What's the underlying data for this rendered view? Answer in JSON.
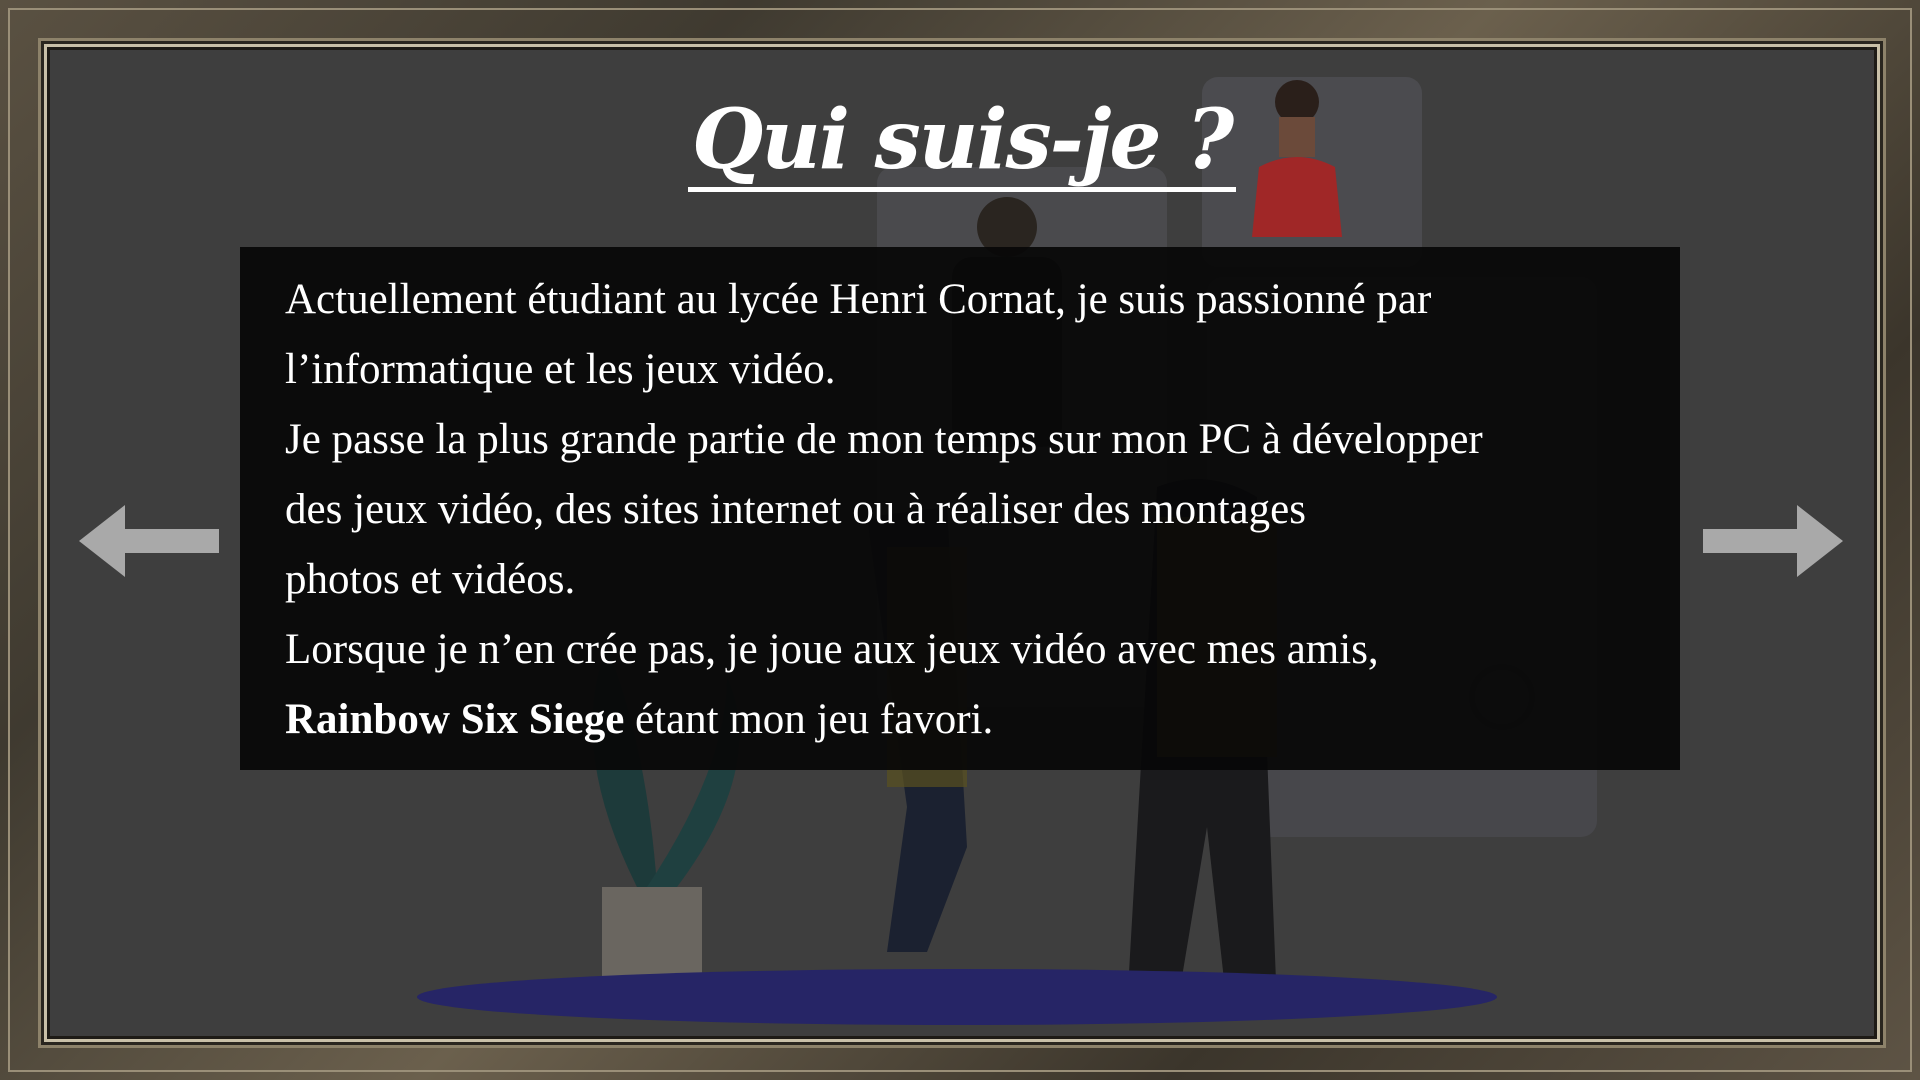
{
  "slide": {
    "title": "Qui suis-je ?",
    "paragraph": {
      "line1": "Actuellement étudiant au lycée Henri Cornat, je suis passionné par",
      "line2": "l’informatique et les jeux vidéo.",
      "line3": "Je passe la plus grande partie de mon temps sur mon PC à développer",
      "line4": "des jeux vidéo, des sites internet ou à réaliser des montages",
      "line5": "photos et vidéos.",
      "line6": "Lorsque je n’en crée pas, je joue aux jeux vidéo avec mes amis,",
      "line7_bold": "Rainbow Six Siege",
      "line7_rest": " étant mon jeu favori."
    }
  },
  "navigation": {
    "prev_icon": "arrow-left-icon",
    "next_icon": "arrow-right-icon"
  },
  "colors": {
    "arrow": "#a9a9a9",
    "background": "#3e3e3e",
    "textbox": "#080808"
  }
}
